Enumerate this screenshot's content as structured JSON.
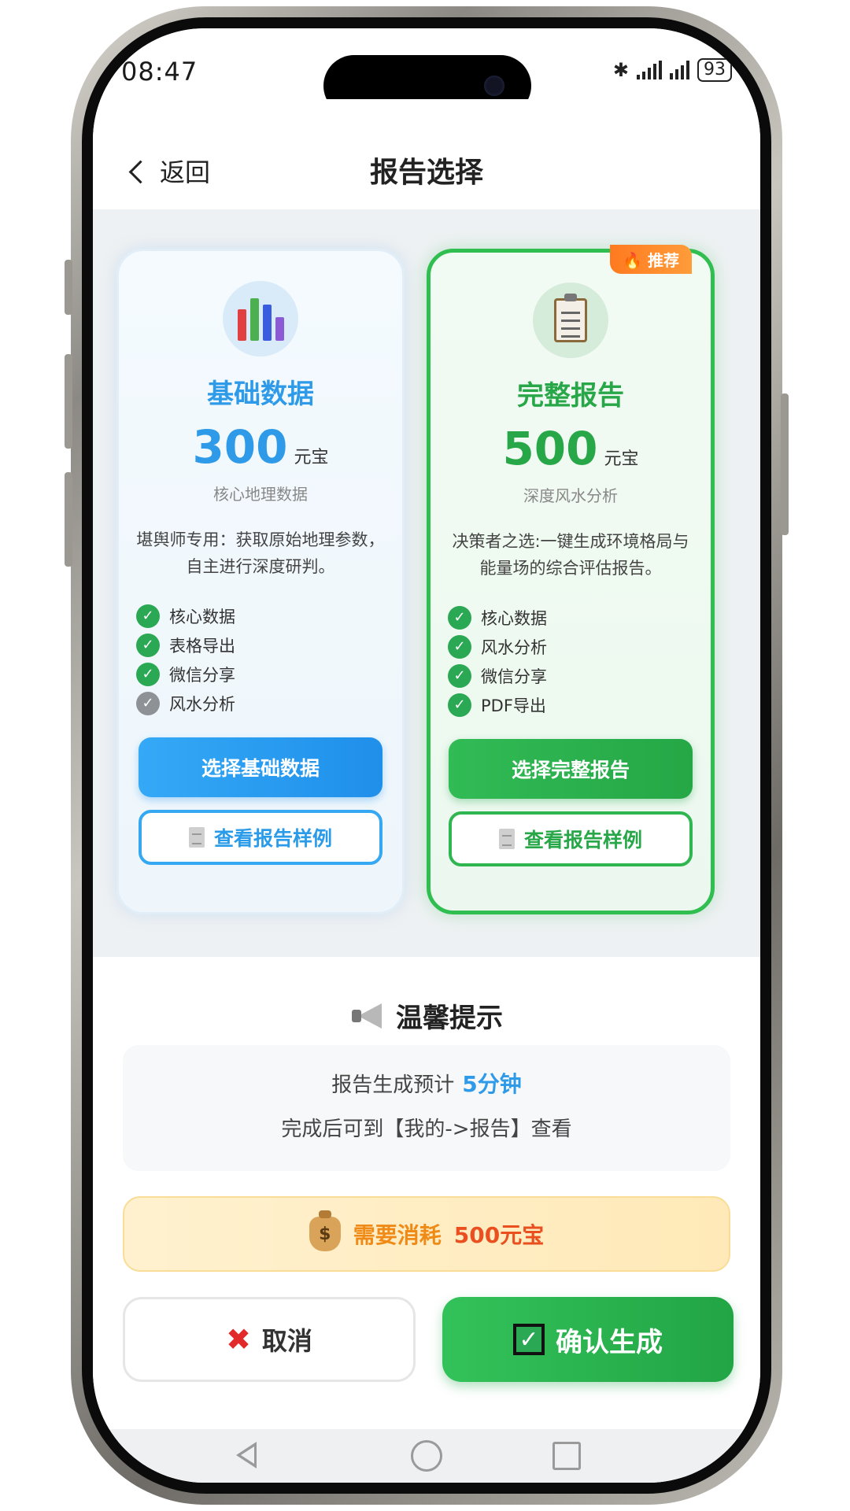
{
  "status_bar": {
    "time": "08:47",
    "battery": "93"
  },
  "header": {
    "back_label": "返回",
    "title": "报告选择"
  },
  "plans": {
    "basic": {
      "title": "基础数据",
      "price": "300",
      "unit": "元宝",
      "subtitle": "核心地理数据",
      "description": "堪舆师专用：获取原始地理参数，自主进行深度研判。",
      "features": [
        {
          "label": "核心数据",
          "included": true
        },
        {
          "label": "表格导出",
          "included": true
        },
        {
          "label": "微信分享",
          "included": true
        },
        {
          "label": "风水分析",
          "included": false
        }
      ],
      "select_label": "选择基础数据",
      "sample_label": "查看报告样例",
      "icon": "bar-chart-icon",
      "accent": "#2f9be8"
    },
    "full": {
      "badge": "🔥 推荐",
      "title": "完整报告",
      "price": "500",
      "unit": "元宝",
      "subtitle": "深度风水分析",
      "description": "决策者之选:一键生成环境格局与能量场的综合评估报告。",
      "features": [
        {
          "label": "核心数据",
          "included": true
        },
        {
          "label": "风水分析",
          "included": true
        },
        {
          "label": "微信分享",
          "included": true
        },
        {
          "label": "PDF导出",
          "included": true
        }
      ],
      "select_label": "选择完整报告",
      "sample_label": "查看报告样例",
      "icon": "clipboard-icon",
      "accent": "#27a748"
    }
  },
  "tips": {
    "title": "温馨提示",
    "line1_prefix": "报告生成预计",
    "line1_highlight": "5分钟",
    "line2": "完成后可到【我的->报告】查看"
  },
  "cost": {
    "prefix": "需要消耗",
    "amount": "500元宝"
  },
  "actions": {
    "cancel_label": "取消",
    "confirm_label": "确认生成"
  }
}
